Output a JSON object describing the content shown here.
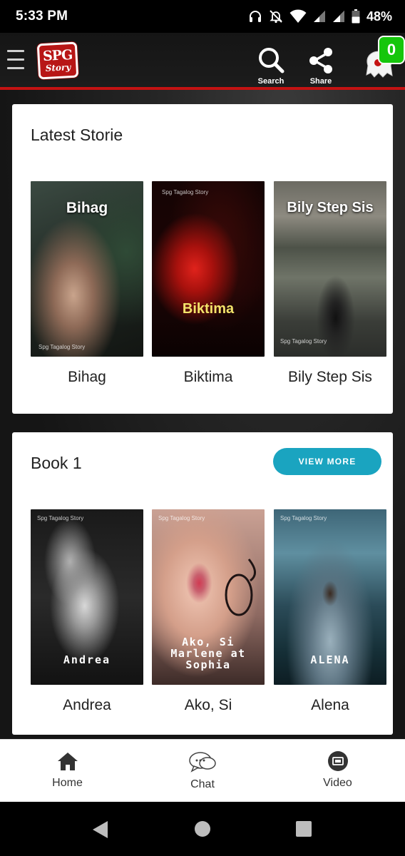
{
  "status_bar": {
    "time": "5:33 PM",
    "battery": "48%",
    "icons": [
      "headphones-icon",
      "mute-bell-icon",
      "wifi-icon",
      "signal-icon",
      "signal-icon",
      "battery-icon"
    ]
  },
  "app_bar": {
    "logo_top": "SPG",
    "logo_bottom": "Story",
    "search_label": "Search",
    "share_label": "Share",
    "badge_count": "0",
    "accent_color": "#c41212",
    "badge_color": "#16c60c"
  },
  "latest": {
    "title": "Latest Storie",
    "books": [
      {
        "label": "Bihag",
        "cover_title": "Bihag",
        "cover_small": "Spg Tagalog Story"
      },
      {
        "label": "Biktima",
        "cover_title": "Biktima",
        "cover_small": "Spg Tagalog Story"
      },
      {
        "label": "Bily Step Sis",
        "cover_title": "Bily Step Sis",
        "cover_small": "Spg Tagalog Story"
      }
    ]
  },
  "book1": {
    "title": "Book 1",
    "view_more": "VIEW MORE",
    "view_more_color": "#1aa4c0",
    "books": [
      {
        "label": "Andrea",
        "cover_title": "Andrea",
        "cover_small": "Spg Tagalog Story"
      },
      {
        "label": "Ako, Si",
        "cover_title": "Ako, Si Marlene at Sophia",
        "cover_small": "Spg Tagalog Story"
      },
      {
        "label": "Alena",
        "cover_title": "ALENA",
        "cover_small": "Spg Tagalog Story"
      }
    ]
  },
  "bottom_nav": {
    "items": [
      {
        "label": "Home",
        "icon": "home-icon"
      },
      {
        "label": "Chat",
        "icon": "chat-icon"
      },
      {
        "label": "Video",
        "icon": "video-icon"
      }
    ]
  },
  "system_nav": [
    "back-icon",
    "home-circle-icon",
    "recents-icon"
  ]
}
